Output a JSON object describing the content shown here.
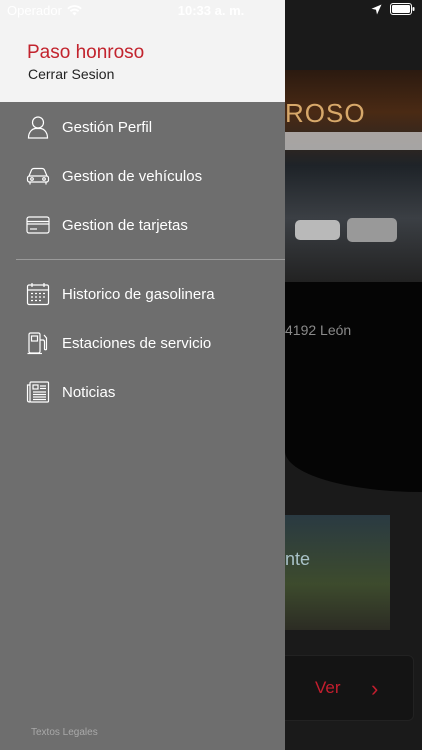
{
  "status_bar": {
    "carrier": "Operador",
    "time": "10:33 a. m."
  },
  "drawer": {
    "brand": "Paso honroso",
    "logout_label": "Cerrar Sesion",
    "menu_group_1": [
      {
        "label": "Gestión Perfil",
        "icon": "user-icon"
      },
      {
        "label": "Gestion de vehículos",
        "icon": "car-icon"
      },
      {
        "label": "Gestion de tarjetas",
        "icon": "credit-card-icon"
      }
    ],
    "menu_group_2": [
      {
        "label": "Historico de gasolinera",
        "icon": "calendar-icon"
      },
      {
        "label": "Estaciones de servicio",
        "icon": "fuel-pump-icon"
      },
      {
        "label": "Noticias",
        "icon": "newspaper-icon"
      }
    ],
    "legal_label": "Textos Legales"
  },
  "background_screen": {
    "photo_sign": "ROSO",
    "address": "4192 León",
    "promo_text": "nte",
    "button_label": "Ver"
  },
  "colors": {
    "brand_red": "#c2232d",
    "drawer_bg": "#6e6e6e",
    "header_bg": "#f3f3f3"
  }
}
